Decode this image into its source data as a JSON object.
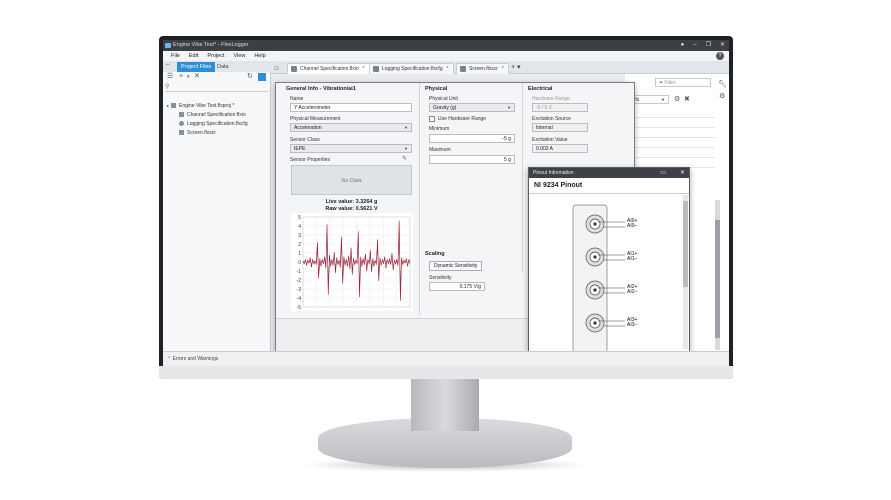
{
  "window": {
    "title": "Engine Vibe Test* - FlexLogger",
    "controls": [
      "●",
      "–",
      "❐",
      "✕"
    ]
  },
  "menu": [
    "File",
    "Edit",
    "Project",
    "View",
    "Help"
  ],
  "left_panel": {
    "tabs": [
      {
        "label": "Project Files",
        "active": true
      },
      {
        "label": "Data",
        "active": false
      }
    ],
    "tree": [
      {
        "label": "Engine Vibe Test.flxproj *",
        "level": 0
      },
      {
        "label": "Channel Specification.flxio",
        "level": 1
      },
      {
        "label": "Logging Specification.flxcfg",
        "level": 1
      },
      {
        "label": "Screen.flxscr",
        "level": 1
      }
    ]
  },
  "doc_tabs": [
    {
      "label": "Channel Specification.flxio",
      "active": true
    },
    {
      "label": "Logging Specification.flxcfg",
      "active": false
    },
    {
      "label": "Screen.flxscr",
      "active": false
    }
  ],
  "right_panel": {
    "filter_placeholder": "Filter",
    "hz_value": "0 Hz"
  },
  "bottom_bar": {
    "label": "Errors and Warnings"
  },
  "general": {
    "title": "General Info - Vibration/ai1",
    "name_label": "Name",
    "name_value": "Y Accelerometer",
    "measurement_label": "Physical Measurement",
    "measurement_value": "Acceleration",
    "sensor_class_label": "Sensor Class",
    "sensor_class_value": "IEPE",
    "sensor_props_label": "Sensor Properties",
    "no_data": "No Data",
    "live_value": "Live value: 3.3264 g",
    "raw_value": "Raw value: 0.5621 V"
  },
  "physical": {
    "title": "Physical",
    "unit_label": "Physical Unit",
    "unit_value": "Gravity (g)",
    "use_hw_range": "Use Hardware Range",
    "min_label": "Minimum",
    "min_value": "-5 g",
    "max_label": "Maximum",
    "max_value": "5 g"
  },
  "electrical": {
    "title": "Electrical",
    "hw_range_label": "Hardware Range",
    "hw_range_value": "-5 / 5 V",
    "excitation_source_label": "Excitation Source",
    "excitation_source_value": "Internal",
    "excitation_value_label": "Excitation Value",
    "excitation_value": "0.002 A"
  },
  "scaling": {
    "title": "Scaling",
    "button": "Dynamic Sensitivity",
    "sensitivity_label": "Sensitivity",
    "sensitivity_value": "0.175 V/g"
  },
  "pinout": {
    "title": "Pinout Information",
    "heading": "NI 9234 Pinout",
    "pins": [
      "AI0+",
      "AI0–",
      "AI1+",
      "AI1–",
      "AI2+",
      "AI2–",
      "AI3+",
      "AI3–"
    ]
  },
  "chart_data": {
    "type": "line",
    "y_ticks": [
      "5",
      "4",
      "3",
      "2",
      "1",
      "0",
      "-1",
      "-2",
      "-3",
      "-4",
      "-5"
    ],
    "ylim": [
      -5,
      5
    ],
    "series": [
      {
        "color": "#a01822",
        "values": [
          0.1,
          -0.2,
          0.3,
          -0.4,
          0.2,
          -0.1,
          0.5,
          -0.6,
          0.3,
          -0.2,
          0.1,
          -0.3,
          2.2,
          -1.8,
          0.4,
          -0.5,
          0.3,
          -0.2,
          0.6,
          -0.7,
          4.2,
          -3.6,
          0.8,
          -0.5,
          0.3,
          -0.4,
          1.1,
          -1.2,
          0.5,
          -0.3,
          0.2,
          -0.6,
          2.8,
          -2.4,
          0.6,
          -0.4,
          0.3,
          -0.5,
          0.7,
          -0.8,
          1.6,
          -1.4,
          0.4,
          -0.3,
          0.2,
          -0.2,
          3.4,
          -3.9,
          0.6,
          -0.5,
          0.4,
          -0.3,
          0.9,
          -1.0,
          0.3,
          -0.2,
          1.3,
          -1.1,
          0.4,
          -0.5,
          0.2,
          -0.3,
          2.5,
          -2.1,
          0.5,
          -0.4,
          0.3,
          -0.2,
          0.6,
          -0.7,
          0.3,
          -0.2,
          0.4,
          -0.3,
          1.0,
          -0.9,
          0.2,
          -0.2,
          0.3,
          -0.4,
          4.6,
          -4.3,
          0.5,
          -0.3,
          0.2,
          -0.1,
          0.4,
          -0.5,
          0.3,
          -0.2
        ]
      },
      {
        "color": "#5577c8",
        "values": [
          0.0,
          0.0,
          0.1,
          -0.1,
          0.0,
          0.0,
          0.2,
          -0.2,
          0.0,
          0.0,
          0.1,
          -0.1,
          1.2,
          -1.0,
          0.1,
          -0.1,
          0.0,
          0.0,
          0.2,
          -0.2,
          3.0,
          -2.6,
          0.2,
          -0.1,
          0.0,
          0.0,
          0.5,
          -0.6,
          0.1,
          -0.1,
          0.0,
          -0.1,
          1.8,
          -1.6,
          0.2,
          -0.1,
          0.0,
          -0.1,
          0.3,
          -0.3,
          0.9,
          -0.8,
          0.1,
          -0.1,
          0.0,
          0.0,
          2.4,
          -2.8,
          0.2,
          -0.1,
          0.1,
          0.0,
          0.4,
          -0.4,
          0.1,
          0.0,
          0.6,
          -0.5,
          0.1,
          -0.1,
          0.0,
          0.0,
          1.5,
          -1.2,
          0.1,
          -0.1,
          0.0,
          0.0,
          0.2,
          -0.2,
          0.1,
          0.0,
          0.1,
          -0.1,
          0.5,
          -0.4,
          0.0,
          0.0,
          0.1,
          -0.1,
          3.3,
          -3.0,
          0.1,
          -0.1,
          0.0,
          0.0,
          0.1,
          -0.1,
          0.1,
          0.0
        ]
      }
    ]
  }
}
